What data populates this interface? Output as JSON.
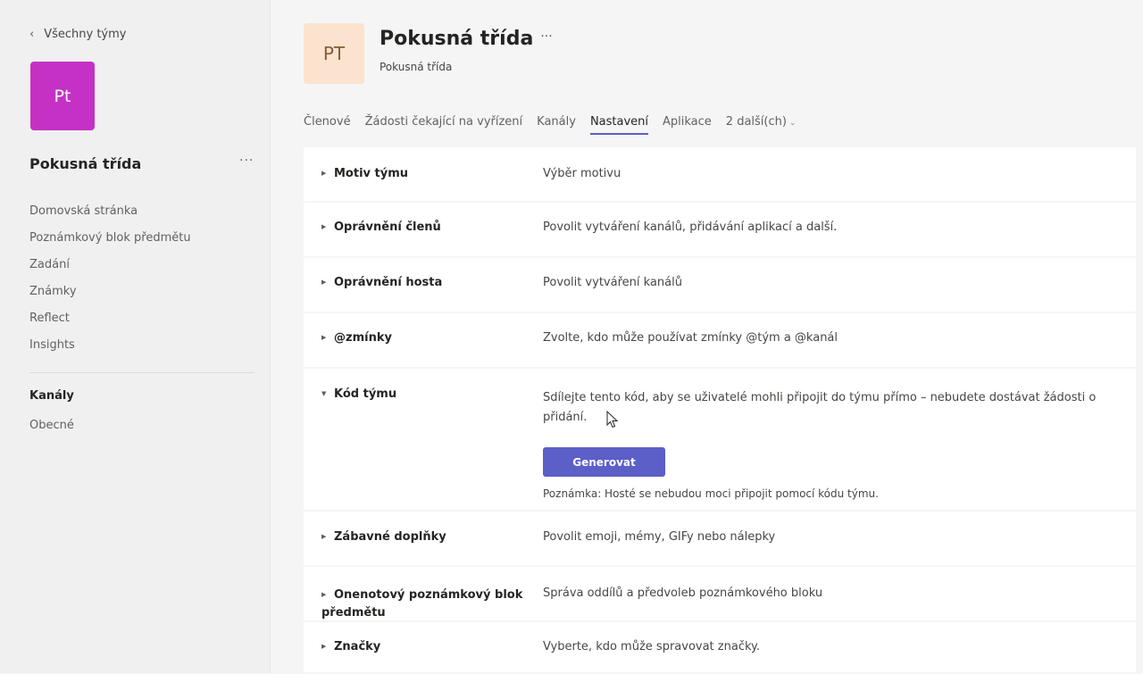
{
  "sidebar": {
    "back_label": "Všechny týmy",
    "team_avatar": "Pt",
    "team_name": "Pokusná třída",
    "more": "···",
    "nav": [
      "Domovská stránka",
      "Poznámkový blok předmětu",
      "Zadání",
      "Známky",
      "Reflect",
      "Insights"
    ],
    "channels_heading": "Kanály",
    "channels": [
      "Obecné"
    ]
  },
  "header": {
    "avatar": "PT",
    "title": "Pokusná třída",
    "more": "···",
    "subtitle": "Pokusná třída"
  },
  "tabs": [
    {
      "label": "Členové"
    },
    {
      "label": "Žádosti čekající na vyřízení"
    },
    {
      "label": "Kanály"
    },
    {
      "label": "Nastavení",
      "active": true
    },
    {
      "label": "Aplikace"
    },
    {
      "label": "2 další(ch)"
    }
  ],
  "settings": {
    "motiv": {
      "label": "Motiv týmu",
      "desc": "Výběr motivu"
    },
    "opravneni_clenu": {
      "label": "Oprávnění členů",
      "desc": "Povolit vytváření kanálů, přidávání aplikací a další."
    },
    "opravneni_hosta": {
      "label": "Oprávnění hosta",
      "desc": "Povolit vytváření kanálů"
    },
    "zminky": {
      "label": "@zmínky",
      "desc": "Zvolte, kdo může používat zmínky @tým a @kanál"
    },
    "kod_tymu": {
      "label": "Kód týmu",
      "desc": "Sdílejte tento kód, aby se uživatelé mohli připojit do týmu přímo – nebudete dostávat žádosti o přidání.",
      "button": "Generovat",
      "note": "Poznámka: Hosté se nebudou moci připojit pomocí kódu týmu."
    },
    "zabavne": {
      "label": "Zábavné doplňky",
      "desc": "Povolit emoji, mémy, GIFy nebo nálepky"
    },
    "onenote": {
      "label": "Onenotový poznámkový blok předmětu",
      "desc": "Správa oddílů a předvoleb poznámkového bloku"
    },
    "znacky": {
      "label": "Značky",
      "desc": "Vyberte, kdo může spravovat značky."
    }
  },
  "colors": {
    "accent": "#5b5fc7",
    "team_avatar_bg": "#c531c5",
    "header_avatar_bg": "#fbe3cf"
  }
}
